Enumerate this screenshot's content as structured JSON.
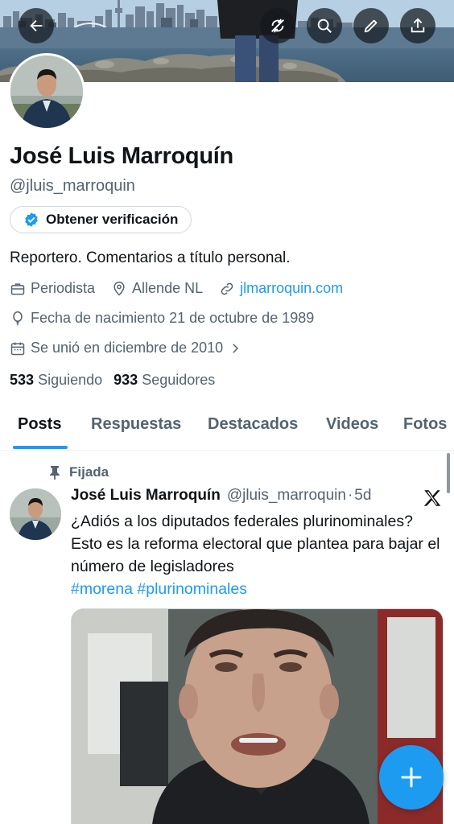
{
  "profile": {
    "name": "José Luis Marroquín",
    "handle": "@jluis_marroquin",
    "verify_label": "Obtener verificación",
    "bio": "Reportero. Comentarios a título personal.",
    "profession": "Periodista",
    "location": "Allende NL",
    "website": "jlmarroquin.com",
    "birthday": "Fecha de nacimiento 21 de octubre de 1989",
    "joined": "Se unió en diciembre de 2010",
    "following_count": "533",
    "following_label": "Siguiendo",
    "followers_count": "933",
    "followers_label": "Seguidores"
  },
  "top_bar": {
    "icons": [
      "back-arrow-icon",
      "refresh-off-icon",
      "search-icon",
      "edit-pencil-icon",
      "share-upload-icon"
    ]
  },
  "tabs": [
    {
      "label": "Posts",
      "active": true
    },
    {
      "label": "Respuestas",
      "active": false
    },
    {
      "label": "Destacados",
      "active": false
    },
    {
      "label": "Videos",
      "active": false
    },
    {
      "label": "Fotos",
      "active": false
    }
  ],
  "post": {
    "pinned_label": "Fijada",
    "author_name": "José Luis Marroquín",
    "author_handle": "@jluis_marroquin",
    "separator": "·",
    "time": "5d",
    "text": "¿Adiós a los diputados federales plurinominales? Esto es la reforma electoral que plantea para bajar el número de legisladores",
    "hashtags": [
      "#morena",
      "#plurinominales"
    ]
  },
  "colors": {
    "accent": "#1d9bf0",
    "text_primary": "#0f1419",
    "text_secondary": "#536471"
  }
}
